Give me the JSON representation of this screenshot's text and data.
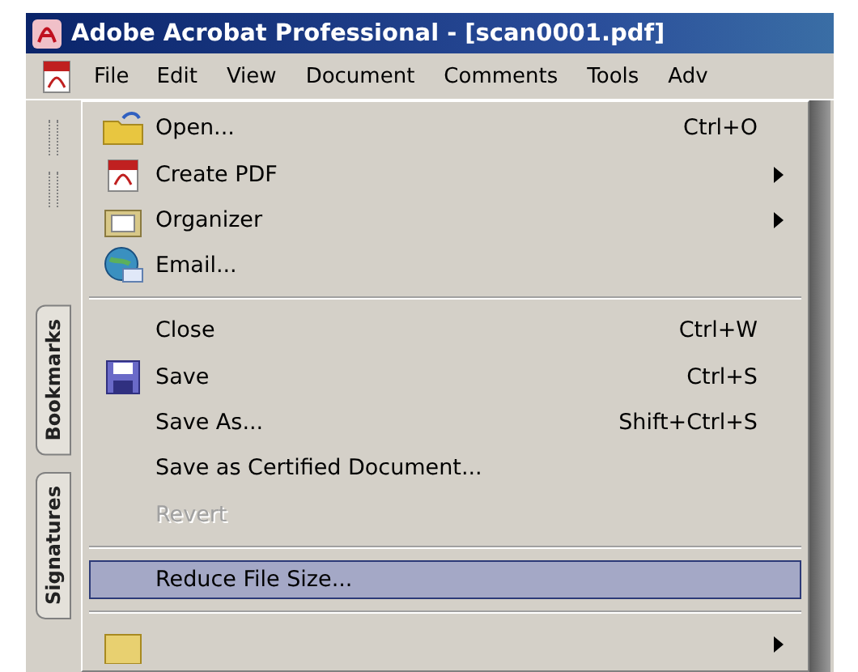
{
  "window": {
    "title": "Adobe Acrobat Professional - [scan0001.pdf]"
  },
  "menubar": [
    {
      "label": "File",
      "selected": true
    },
    {
      "label": "Edit",
      "selected": false
    },
    {
      "label": "View",
      "selected": false
    },
    {
      "label": "Document",
      "selected": false
    },
    {
      "label": "Comments",
      "selected": false
    },
    {
      "label": "Tools",
      "selected": false
    },
    {
      "label": "Adv",
      "selected": false
    }
  ],
  "side_tabs": [
    "Bookmarks",
    "Signatures"
  ],
  "file_menu": [
    {
      "kind": "item",
      "label": "Open...",
      "shortcut": "Ctrl+O",
      "has_icon": true,
      "submenu": false,
      "disabled": false,
      "selected": false
    },
    {
      "kind": "item",
      "label": "Create PDF",
      "has_icon": true,
      "submenu": true,
      "disabled": false,
      "selected": false
    },
    {
      "kind": "item",
      "label": "Organizer",
      "has_icon": true,
      "submenu": true,
      "disabled": false,
      "selected": false
    },
    {
      "kind": "item",
      "label": "Email...",
      "has_icon": true,
      "submenu": false,
      "disabled": false,
      "selected": false
    },
    {
      "kind": "separator"
    },
    {
      "kind": "item",
      "label": "Close",
      "shortcut": "Ctrl+W",
      "has_icon": false,
      "submenu": false,
      "disabled": false,
      "selected": false
    },
    {
      "kind": "item",
      "label": "Save",
      "shortcut": "Ctrl+S",
      "has_icon": true,
      "submenu": false,
      "disabled": false,
      "selected": false
    },
    {
      "kind": "item",
      "label": "Save As...",
      "shortcut": "Shift+Ctrl+S",
      "has_icon": false,
      "submenu": false,
      "disabled": false,
      "selected": false
    },
    {
      "kind": "item",
      "label": "Save as Certified Document...",
      "has_icon": false,
      "submenu": false,
      "disabled": false,
      "selected": false
    },
    {
      "kind": "item",
      "label": "Revert",
      "has_icon": false,
      "submenu": false,
      "disabled": true,
      "selected": false
    },
    {
      "kind": "separator"
    },
    {
      "kind": "item",
      "label": "Reduce File Size...",
      "has_icon": false,
      "submenu": false,
      "disabled": false,
      "selected": true
    },
    {
      "kind": "separator"
    }
  ]
}
